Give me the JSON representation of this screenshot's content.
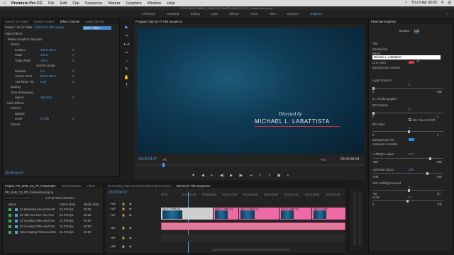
{
  "menubar": {
    "app": "Premiere Pro CC",
    "items": [
      "File",
      "Edit",
      "Clip",
      "Sequence",
      "Marker",
      "Graphics",
      "Window",
      "Help"
    ],
    "clock": "Thu 6 Apr 00:03"
  },
  "path": "/FOOTAGE/TMAILD/_NAB17/PrPro/PR_NAB_O2_PP_Featurettes.prproj *",
  "workspaces": {
    "items": [
      "All Panels",
      "Assembly",
      "Editing",
      "Color",
      "Effects",
      "Audio",
      "Titles",
      "Libraries",
      "Graphics"
    ],
    "active": "Graphics"
  },
  "effect_controls": {
    "tabs": [
      "Source: (no clips)",
      "Lumetri Scopes",
      "Effect Controls",
      "Audio Clip Mix"
    ],
    "active_tab": "Effect Controls",
    "master": "Master * Sci-Fi Titles",
    "seq": "03d Sci-Fi Title Seque...",
    "clip_label": "Sci-Fi Titles",
    "video_effects": "Video Effects",
    "rows": [
      {
        "label": "Motion Graphics Template",
        "indent": 4
      },
      {
        "label": "Motion",
        "indent": 8,
        "value": ""
      },
      {
        "label": "Position",
        "indent": 14,
        "value": "960.0   540.0"
      },
      {
        "label": "Scale",
        "indent": 14,
        "value": "100.0"
      },
      {
        "label": "Scale Width",
        "indent": 14,
        "value": "100.0"
      },
      {
        "label": "Uniform Scale",
        "indent": 44,
        "value": ""
      },
      {
        "label": "Rotation",
        "indent": 14,
        "value": "0.0"
      },
      {
        "label": "Anchor Point",
        "indent": 14,
        "value": "960.0   540.0"
      },
      {
        "label": "Anti-flicker Filt...",
        "indent": 14,
        "value": "0.00"
      },
      {
        "label": "Opacity",
        "indent": 8,
        "value": ""
      },
      {
        "label": "Time Remapping",
        "indent": 8,
        "value": ""
      },
      {
        "label": "Speed",
        "indent": 14,
        "value": "100.00%"
      },
      {
        "label": "Audio Effects",
        "indent": 2,
        "value": ""
      },
      {
        "label": "Volume",
        "indent": 8,
        "value": ""
      },
      {
        "label": "Bypass",
        "indent": 14,
        "value": ""
      },
      {
        "label": "Level",
        "indent": 14,
        "value": "0.0 dB"
      },
      {
        "label": "Panner",
        "indent": 8,
        "value": ""
      }
    ],
    "timecode": "00:00:04:07"
  },
  "program": {
    "title": "Program: 03d Sci-Fi Title Sequence",
    "directed_by": "Directed by",
    "name": "MICHAEL L. LABATTISTA",
    "timecode": "00:00:04:07",
    "fit": "Fit",
    "quality": "Full",
    "duration": "00:00:35:04"
  },
  "essential_graphics": {
    "title": "Essential Graphics",
    "tabs": [
      "Browse",
      "Edit"
    ],
    "active_tab": "Edit",
    "title_label": "Title",
    "directed_by": "Directed by",
    "name_label": "Name",
    "name_value": "Michael L. LaBattista",
    "line_color": "Line Color",
    "bg_controls": "Background Controls",
    "light_direction": "Light Direction",
    "ld_min": "0",
    "ld_max": "360",
    "ld_val": "0",
    "no_bg": "0 = No BG graphic",
    "bg_graphic": "BG Graphic",
    "bgg_val": "0",
    "bgg_min": "0",
    "bgg_max": "2",
    "bg_video": "BG Video On/Off",
    "bg_video_lbl": "BG Video",
    "bgv_val": "1",
    "bgv_min": "0",
    "bgv_max": "2",
    "bg_tint": "Background Tint",
    "anim_controls": "Animation Controls",
    "lr_adjust": "Left/Right Adjust",
    "lr_val": "573",
    "lr_min": "-960",
    "lr_max": "960",
    "ud_adjust": "Up/Down Adjust",
    "ud_val": "285",
    "ud_min": "-540",
    "ud_max": "540",
    "drift": "Drift Left/Right Speed",
    "drift_val": "0",
    "drift_min": "-50",
    "drift_max": "50",
    "scale": "Scale",
    "scale_val": "97",
    "scale_min": "0",
    "scale_max": "200",
    "line_color_hex": "#d8344a"
  },
  "project": {
    "tabs": [
      "Project: PR_NAB_O2_PP_Featurettes",
      "Media Browser",
      "Librari"
    ],
    "file": "PR_NAB_O2_PP_Featurettes.prproj",
    "selection": "1 of 41 items selected",
    "columns": [
      "Name",
      "Frame Rate",
      "Media Start"
    ],
    "items": [
      {
        "name": "01 Essential Sound Workfl",
        "rate": "23.976 fps",
        "start": "00:00"
      },
      {
        "name": "02 Title bed See You Arou",
        "rate": "23.976 fps",
        "start": "00:00"
      },
      {
        "name": "03 Creating Titles and Ess",
        "rate": "23.976 fps",
        "start": "00:00"
      },
      {
        "name": "03 Creating Titles and Ess",
        "rate": "23.976 fps",
        "start": "00:00"
      },
      {
        "name": "03a Creating Titles and Ess",
        "rate": "23.976 fps",
        "start": "00:00"
      }
    ]
  },
  "timeline": {
    "tabs": [
      "03 Creating Titles and Essential Graphics Panel",
      "03d Sci-Fi Title Sequence"
    ],
    "active_tab": "03d Sci-Fi Title Sequence",
    "timecode": "00:00:04:07",
    "ruler": [
      "00:00",
      "00:00:04:00",
      "00:00:08:00",
      "00:00:12:00",
      "00:00:16:00",
      "00:00:20:00",
      "00:00:24:00",
      "00:00:28:00",
      "00:00:32:00"
    ],
    "tracks": [
      "V3",
      "V2",
      "V1",
      "A1",
      "A2",
      "A3"
    ],
    "clip_label": "Sci-Fi Titles [V]",
    "clip_label_short": "Sci-Fi Titles"
  }
}
